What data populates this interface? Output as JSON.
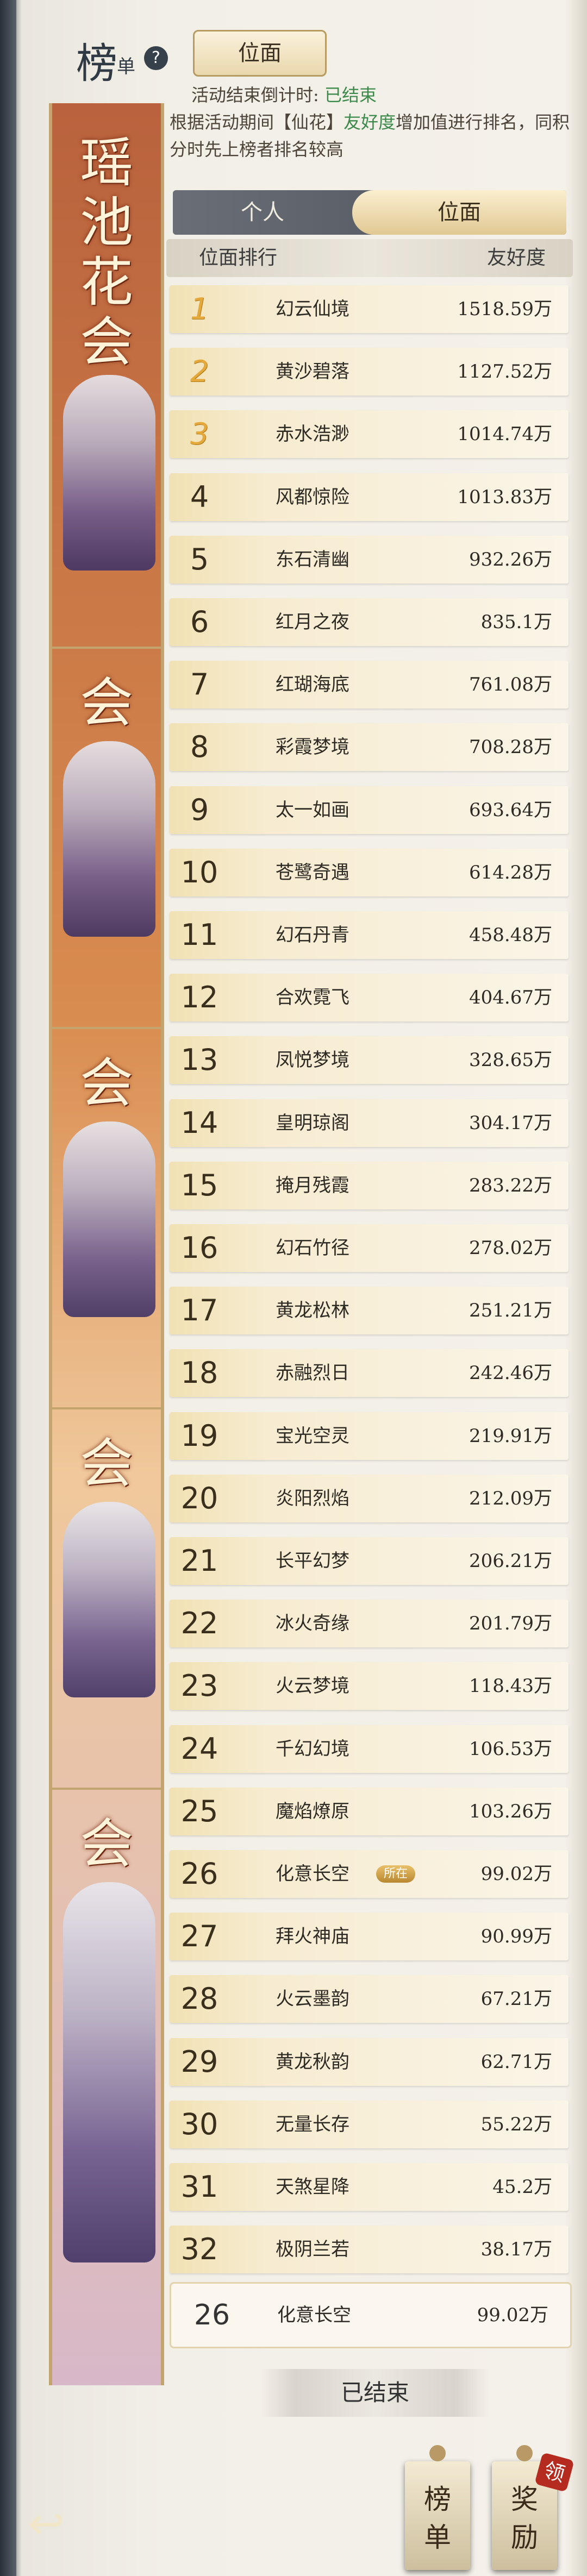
{
  "header": {
    "title_big": "榜",
    "title_small": "单",
    "help": "?",
    "realm_button": "位面"
  },
  "info": {
    "countdown_label": "活动结束倒计时:",
    "countdown_value": "已结束",
    "desc_prefix": "根据活动期间【仙花】",
    "desc_highlight": "友好度",
    "desc_suffix": "增加值进行排名，同积分时先上榜者排名较高"
  },
  "spine": {
    "chars": [
      "瑶",
      "池",
      "花",
      "会"
    ],
    "repeat_char": "会"
  },
  "tabs": {
    "personal": "个人",
    "realm": "位面"
  },
  "columns": {
    "rank": "位面排行",
    "score": "友好度"
  },
  "rows": [
    {
      "rank": "1",
      "name": "幻云仙境",
      "score": "1518.59万"
    },
    {
      "rank": "2",
      "name": "黄沙碧落",
      "score": "1127.52万"
    },
    {
      "rank": "3",
      "name": "赤水浩渺",
      "score": "1014.74万"
    },
    {
      "rank": "4",
      "name": "风都惊险",
      "score": "1013.83万"
    },
    {
      "rank": "5",
      "name": "东石清幽",
      "score": "932.26万"
    },
    {
      "rank": "6",
      "name": "红月之夜",
      "score": "835.1万"
    },
    {
      "rank": "7",
      "name": "红瑚海底",
      "score": "761.08万"
    },
    {
      "rank": "8",
      "name": "彩霞梦境",
      "score": "708.28万"
    },
    {
      "rank": "9",
      "name": "太一如画",
      "score": "693.64万"
    },
    {
      "rank": "10",
      "name": "苍鹭奇遇",
      "score": "614.28万"
    },
    {
      "rank": "11",
      "name": "幻石丹青",
      "score": "458.48万"
    },
    {
      "rank": "12",
      "name": "合欢霓飞",
      "score": "404.67万"
    },
    {
      "rank": "13",
      "name": "凤悦梦境",
      "score": "328.65万"
    },
    {
      "rank": "14",
      "name": "皇明琼阁",
      "score": "304.17万"
    },
    {
      "rank": "15",
      "name": "掩月残霞",
      "score": "283.22万"
    },
    {
      "rank": "16",
      "name": "幻石竹径",
      "score": "278.02万"
    },
    {
      "rank": "17",
      "name": "黄龙松林",
      "score": "251.21万"
    },
    {
      "rank": "18",
      "name": "赤融烈日",
      "score": "242.46万"
    },
    {
      "rank": "19",
      "name": "宝光空灵",
      "score": "219.91万"
    },
    {
      "rank": "20",
      "name": "炎阳烈焰",
      "score": "212.09万"
    },
    {
      "rank": "21",
      "name": "长平幻梦",
      "score": "206.21万"
    },
    {
      "rank": "22",
      "name": "冰火奇缘",
      "score": "201.79万"
    },
    {
      "rank": "23",
      "name": "火云梦境",
      "score": "118.43万"
    },
    {
      "rank": "24",
      "name": "千幻幻境",
      "score": "106.53万"
    },
    {
      "rank": "25",
      "name": "魔焰燎原",
      "score": "103.26万"
    },
    {
      "rank": "26",
      "name": "化意长空",
      "score": "99.02万",
      "tag": "所在"
    },
    {
      "rank": "27",
      "name": "拜火神庙",
      "score": "90.99万"
    },
    {
      "rank": "28",
      "name": "火云墨韵",
      "score": "67.21万"
    },
    {
      "rank": "29",
      "name": "黄龙秋韵",
      "score": "62.71万"
    },
    {
      "rank": "30",
      "name": "无量长存",
      "score": "55.22万"
    },
    {
      "rank": "31",
      "name": "天煞星降",
      "score": "45.2万"
    },
    {
      "rank": "32",
      "name": "极阴兰若",
      "score": "38.17万"
    }
  ],
  "my_rank": {
    "rank": "26",
    "name": "化意长空",
    "score": "99.02万"
  },
  "ended_button": "已结束",
  "bottom": {
    "back_icon": "↩",
    "leaderboard_1": "榜",
    "leaderboard_2": "单",
    "reward_1": "奖",
    "reward_2": "励",
    "claim_badge": "领"
  }
}
